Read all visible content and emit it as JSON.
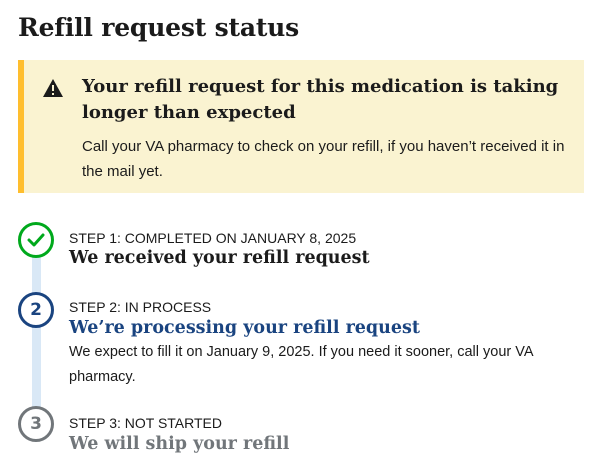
{
  "page": {
    "title": "Refill request status"
  },
  "alert": {
    "icon": "warning-icon",
    "heading": "Your refill request for this medication is taking longer than expected",
    "body": "Call your VA pharmacy to check on your refill, if you haven’t received it in the mail yet.",
    "colors": {
      "background": "#faf3d1",
      "accent": "#ffbe2e"
    }
  },
  "steps": [
    {
      "marker": "check",
      "status": "STEP 1: COMPLETED ON JANUARY 8, 2025",
      "heading": "We received your refill request",
      "color": "#00a91c"
    },
    {
      "marker": "2",
      "status": "STEP 2: IN PROCESS",
      "heading": "We’re processing your refill request",
      "description": "We expect to fill it on January 9, 2025. If you need it sooner, call your VA pharmacy.",
      "color": "#1a4480"
    },
    {
      "marker": "3",
      "status": "STEP 3: NOT STARTED",
      "heading": "We will ship your refill",
      "color": "#71767a"
    }
  ]
}
